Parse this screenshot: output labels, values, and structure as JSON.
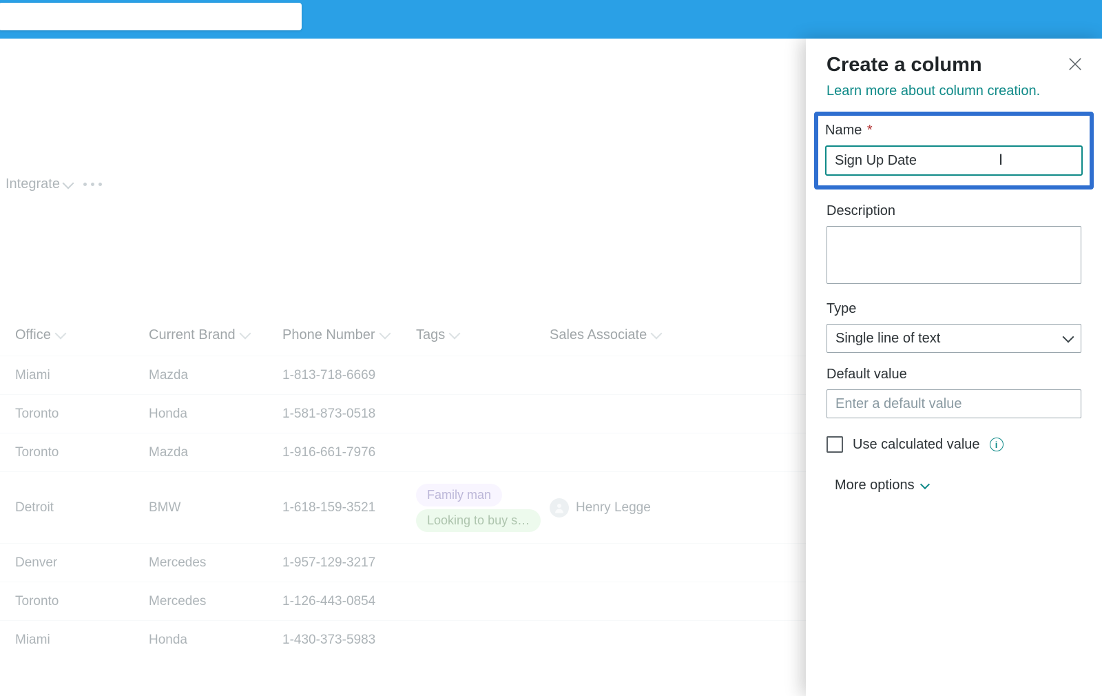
{
  "header": {},
  "toolbar": {
    "integrate": "Integrate"
  },
  "table": {
    "columns": {
      "office": "Office",
      "brand": "Current Brand",
      "phone": "Phone Number",
      "tags": "Tags",
      "associate": "Sales Associate"
    },
    "rows": [
      {
        "office": "Miami",
        "brand": "Mazda",
        "phone": "1-813-718-6669",
        "tags": [],
        "associate": ""
      },
      {
        "office": "Toronto",
        "brand": "Honda",
        "phone": "1-581-873-0518",
        "tags": [],
        "associate": ""
      },
      {
        "office": "Toronto",
        "brand": "Mazda",
        "phone": "1-916-661-7976",
        "tags": [],
        "associate": ""
      },
      {
        "office": "Detroit",
        "brand": "BMW",
        "phone": "1-618-159-3521",
        "tags": [
          "Family man",
          "Looking to buy s…"
        ],
        "associate": "Henry Legge"
      },
      {
        "office": "Denver",
        "brand": "Mercedes",
        "phone": "1-957-129-3217",
        "tags": [],
        "associate": ""
      },
      {
        "office": "Toronto",
        "brand": "Mercedes",
        "phone": "1-126-443-0854",
        "tags": [],
        "associate": ""
      },
      {
        "office": "Miami",
        "brand": "Honda",
        "phone": "1-430-373-5983",
        "tags": [],
        "associate": ""
      }
    ]
  },
  "panel": {
    "title": "Create a column",
    "learn_link": "Learn more about column creation.",
    "name_label": "Name",
    "name_value": "Sign Up Date",
    "desc_label": "Description",
    "desc_value": "",
    "type_label": "Type",
    "type_value": "Single line of text",
    "default_label": "Default value",
    "default_placeholder": "Enter a default value",
    "calc_label": "Use calculated value",
    "more_options": "More options"
  },
  "colors": {
    "accent_teal": "#0f8a88",
    "highlight_blue": "#2f6fd0",
    "top_bar": "#2aa0e6"
  },
  "tags_meta": {
    "Family man": "fam",
    "Looking to buy s…": "buy"
  }
}
